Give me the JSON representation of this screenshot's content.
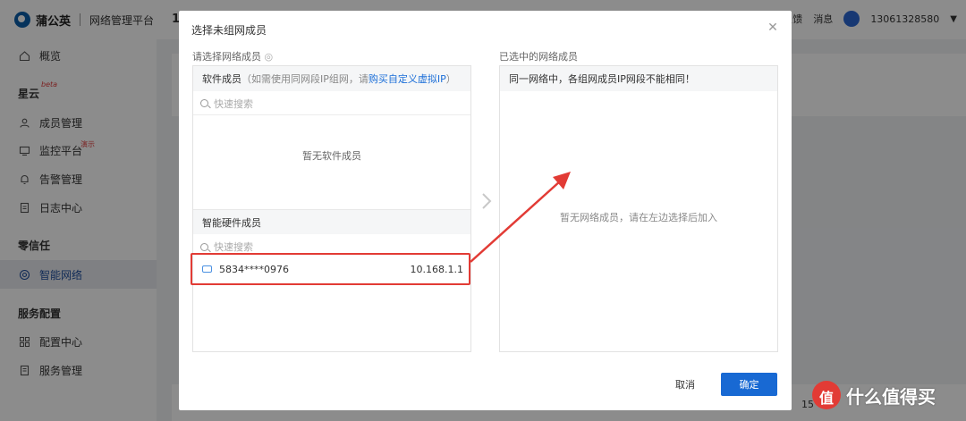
{
  "app": {
    "brand": "蒲公英",
    "subtitle": "网络管理平台",
    "topbar_title_fragment": "1"
  },
  "header": {
    "feedback": "意见反馈",
    "messages": "消息",
    "user_phone": "13061328580"
  },
  "sidebar": {
    "items_top": [
      {
        "label": "概览",
        "icon": "home-icon"
      }
    ],
    "section_star": {
      "title": "星云",
      "badge": "beta"
    },
    "star_items": [
      {
        "label": "成员管理",
        "icon": "members-icon"
      },
      {
        "label": "监控平台",
        "icon": "monitor-icon",
        "badge": "演示"
      },
      {
        "label": "告警管理",
        "icon": "bell-icon"
      },
      {
        "label": "日志中心",
        "icon": "log-icon"
      }
    ],
    "section_zero": {
      "title": "零信任"
    },
    "zero_items": [
      {
        "label": "智能网络",
        "icon": "network-icon",
        "active": true
      }
    ],
    "section_service": {
      "title": "服务配置"
    },
    "service_items": [
      {
        "label": "配置中心",
        "icon": "grid-icon"
      },
      {
        "label": "服务管理",
        "icon": "doc-icon"
      }
    ]
  },
  "modal": {
    "title": "选择未组网成员",
    "left_label": "请选择网络成员",
    "right_label": "已选中的网络成员",
    "software": {
      "head_prefix": "软件成员",
      "head_note_a": "（如需使用同网段IP组网，请",
      "head_link": "购买自定义虚拟IP",
      "head_note_b": "）",
      "search_placeholder": "快速搜索",
      "empty": "暂无软件成员"
    },
    "hardware": {
      "head": "智能硬件成员",
      "search_placeholder": "快速搜索",
      "members": [
        {
          "name": "5834****0976",
          "ip": "10.168.1.1"
        }
      ]
    },
    "right": {
      "head": "同一网络中，各组网成员IP网段不能相同！",
      "empty": "暂无网络成员，请在左边选择后加入"
    },
    "cancel": "取消",
    "confirm": "确定"
  },
  "pagination_fragment": "15",
  "watermark": "什么值得买",
  "colors": {
    "accent": "#1869d3",
    "annotation": "#e23b35",
    "link": "#1d6fd8"
  }
}
